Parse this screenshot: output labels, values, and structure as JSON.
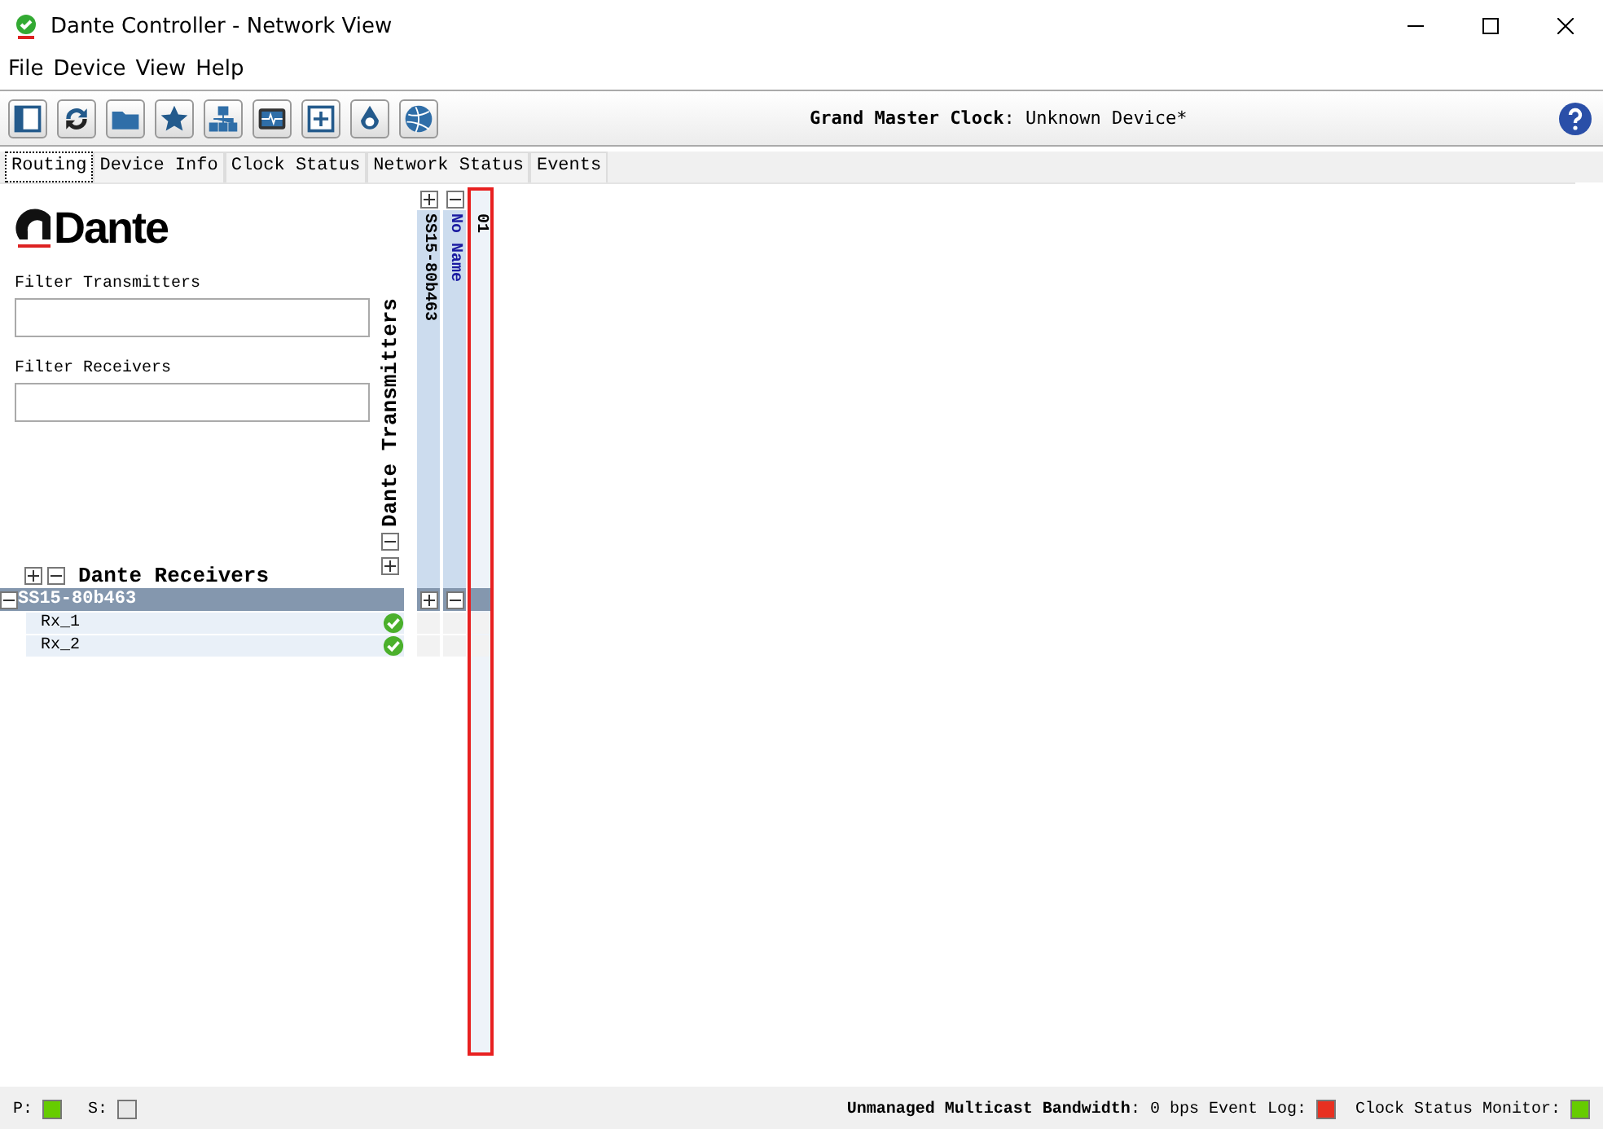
{
  "window": {
    "title": "Dante Controller - Network View"
  },
  "menu": [
    "File",
    "Device",
    "View",
    "Help"
  ],
  "toolbar": [
    {
      "kind": "sidebar"
    },
    {
      "kind": "refresh"
    },
    {
      "kind": "folder"
    },
    {
      "kind": "star"
    },
    {
      "kind": "network"
    },
    {
      "kind": "monitor"
    },
    {
      "kind": "plus"
    },
    {
      "kind": "drop"
    },
    {
      "kind": "globe"
    }
  ],
  "grand_master": {
    "label": "Grand Master Clock",
    "value": ": Unknown Device*"
  },
  "tabs": [
    {
      "label": "Routing",
      "selected": true
    },
    {
      "label": "Device Info",
      "selected": false
    },
    {
      "label": "Clock Status",
      "selected": false
    },
    {
      "label": "Network Status",
      "selected": false
    },
    {
      "label": "Events",
      "selected": false
    }
  ],
  "logo": "Dante",
  "filters": [
    {
      "label": "Filter Transmitters"
    },
    {
      "label": "Filter Receivers"
    }
  ],
  "transmitters_label": "Dante Transmitters",
  "receivers_label": "Dante Receivers",
  "transmitter_columns": [
    {
      "label": "SS15-80b463",
      "expanded": false,
      "highlighted": false
    },
    {
      "label": "No Name",
      "expanded": true,
      "highlighted": false
    },
    {
      "label": "01",
      "highlighted": true
    }
  ],
  "receivers": [
    {
      "label": "SS15-80b463",
      "expanded": true,
      "channels": [
        {
          "label": "Rx_1",
          "ok": true
        },
        {
          "label": "Rx_2",
          "ok": true
        }
      ]
    }
  ],
  "status_bar": {
    "p": {
      "label": "P:",
      "color": "#66cc00"
    },
    "s": {
      "label": "S:",
      "color": "#e8e8e8"
    },
    "bandwidth_label": "Unmanaged Multicast Bandwidth",
    "bandwidth_value": ": 0 bps",
    "event_log": {
      "label": "Event Log:",
      "color": "#e83020"
    },
    "clock_monitor": {
      "label": "Clock Status Monitor:",
      "color": "#66cc00"
    }
  }
}
